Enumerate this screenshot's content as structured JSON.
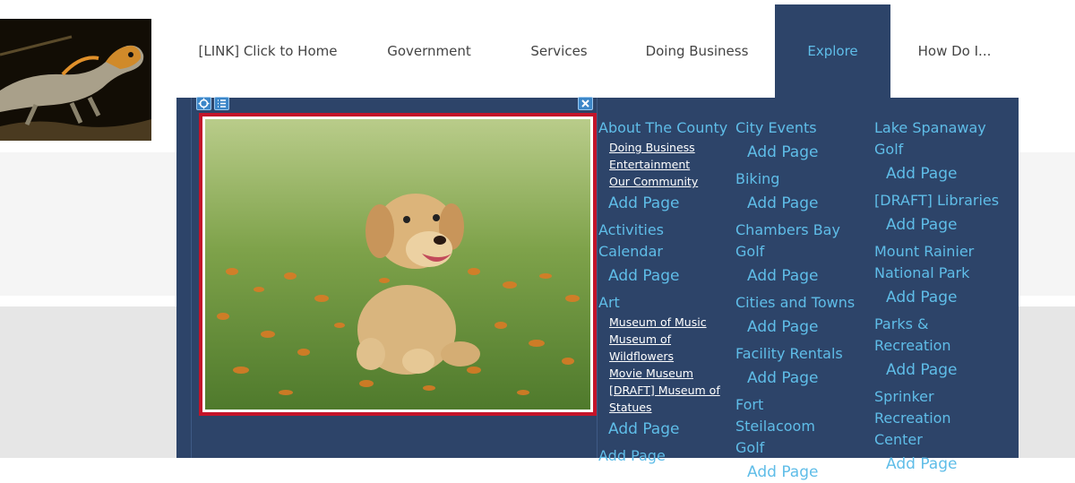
{
  "nav": {
    "items": [
      {
        "label": "[LINK] Click to Home",
        "active": false
      },
      {
        "label": "Government",
        "active": false
      },
      {
        "label": "Services",
        "active": false
      },
      {
        "label": "Doing Business",
        "active": false
      },
      {
        "label": "Explore",
        "active": true
      },
      {
        "label": "How Do I...",
        "active": false
      }
    ]
  },
  "icons": {
    "move": "move-icon",
    "list": "list-icon",
    "close": "close-icon"
  },
  "colors": {
    "panel_bg": "#2d4469",
    "link": "#5fbde8",
    "frame_border": "#c3142a"
  },
  "mega": {
    "col1": {
      "groups": [
        {
          "title": "About The County",
          "subs": [
            "Doing Business",
            "Entertainment",
            "Our Community"
          ],
          "add": "Add Page"
        },
        {
          "title": "Activities Calendar",
          "subs": [],
          "add": "Add Page"
        },
        {
          "title": "Art",
          "subs": [
            "Museum of Music",
            "Museum of Wildflowers",
            "Movie Museum",
            "[DRAFT] Museum of Statues"
          ],
          "add": "Add Page"
        }
      ],
      "add_bottom": "Add Page"
    },
    "col2": [
      {
        "title": "City Events",
        "add": "Add Page"
      },
      {
        "title": "Biking",
        "add": "Add Page"
      },
      {
        "title": "Chambers Bay Golf",
        "add": "Add Page"
      },
      {
        "title": "Cities and Towns",
        "add": "Add Page"
      },
      {
        "title": "Facility Rentals",
        "add": "Add Page"
      },
      {
        "title": "Fort Steilacoom Golf",
        "add": "Add Page"
      }
    ],
    "col3": [
      {
        "title": "Lake Spanaway Golf",
        "add": "Add Page"
      },
      {
        "title": "[DRAFT] Libraries",
        "add": "Add Page"
      },
      {
        "title": "Mount Rainier National Park",
        "add": "Add Page"
      },
      {
        "title": "Parks & Recreation",
        "add": "Add Page"
      },
      {
        "title": "Sprinker Recreation Center",
        "add": "Add Page"
      }
    ]
  }
}
